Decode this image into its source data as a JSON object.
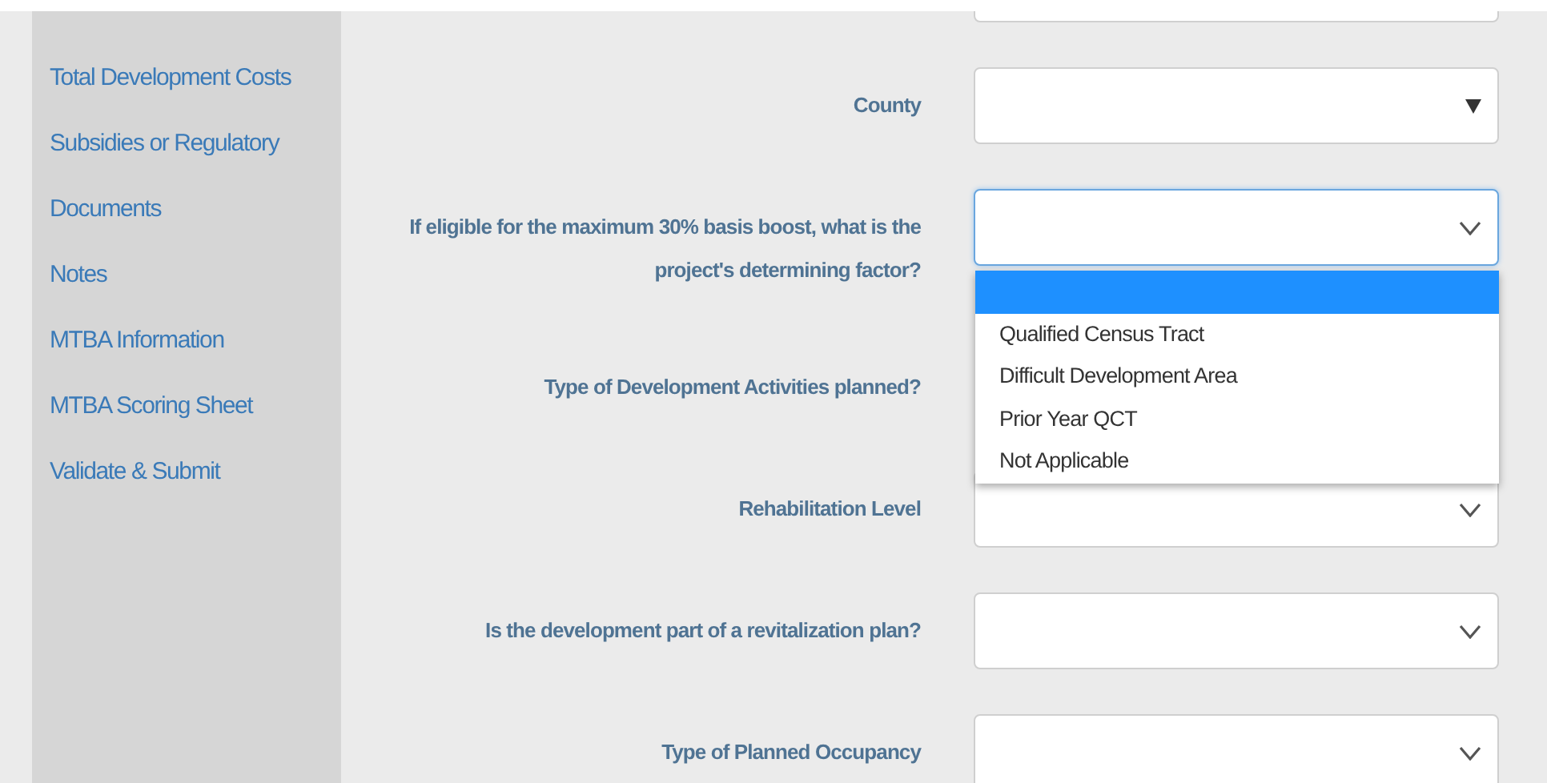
{
  "sidebar": {
    "items": [
      {
        "label": "Total Development Costs"
      },
      {
        "label": "Subsidies or Regulatory"
      },
      {
        "label": "Documents"
      },
      {
        "label": "Notes"
      },
      {
        "label": "MTBA Information"
      },
      {
        "label": "MTBA Scoring Sheet"
      },
      {
        "label": "Validate & Submit"
      }
    ]
  },
  "form": {
    "fields": [
      {
        "kind": "blank",
        "focused": false
      },
      {
        "label": "County",
        "kind": "triangle",
        "focused": false
      },
      {
        "label": "If eligible for the maximum 30% basis boost, what is the project's determining factor?",
        "kind": "chevron",
        "focused": true,
        "dropdown": {
          "blank_option_selected": true,
          "options": [
            {
              "label": "Qualified Census Tract",
              "selected": false
            },
            {
              "label": "Difficult Development Area",
              "selected": false
            },
            {
              "label": "Prior Year QCT",
              "selected": false
            },
            {
              "label": "Not Applicable",
              "selected": false
            }
          ]
        }
      },
      {
        "label": "Type of Development Activities planned?",
        "kind": "covered"
      },
      {
        "label": "Rehabilitation Level",
        "kind": "chevron",
        "focused": false
      },
      {
        "label": "Is the development part of a revitalization plan?",
        "kind": "chevron",
        "focused": false
      },
      {
        "label": "Type of Planned Occupancy",
        "kind": "chevron",
        "focused": false
      }
    ]
  }
}
